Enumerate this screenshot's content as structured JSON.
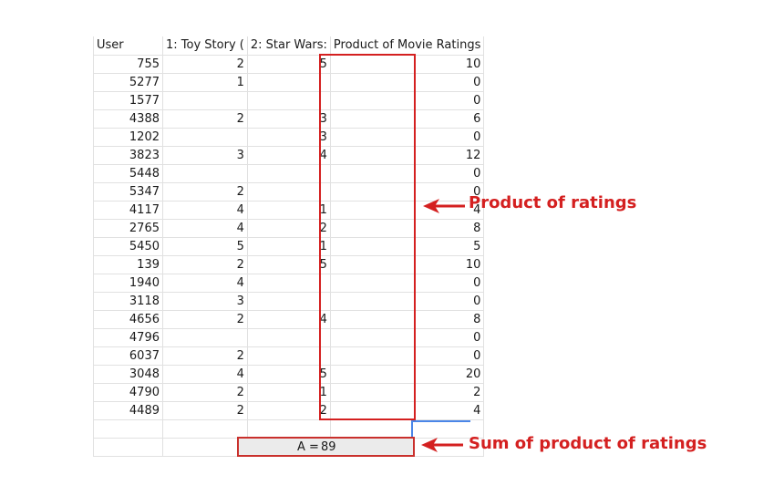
{
  "headers": [
    "User",
    "1: Toy Story (",
    "2: Star Wars:",
    "Product of Movie Ratings"
  ],
  "rows": [
    [
      "755",
      "2",
      "5",
      "10"
    ],
    [
      "5277",
      "1",
      "",
      "0"
    ],
    [
      "1577",
      "",
      "",
      "0"
    ],
    [
      "4388",
      "2",
      "3",
      "6"
    ],
    [
      "1202",
      "",
      "3",
      "0"
    ],
    [
      "3823",
      "3",
      "4",
      "12"
    ],
    [
      "5448",
      "",
      "",
      "0"
    ],
    [
      "5347",
      "2",
      "",
      "0"
    ],
    [
      "4117",
      "4",
      "1",
      "4"
    ],
    [
      "2765",
      "4",
      "2",
      "8"
    ],
    [
      "5450",
      "5",
      "1",
      "5"
    ],
    [
      "139",
      "2",
      "5",
      "10"
    ],
    [
      "1940",
      "4",
      "",
      "0"
    ],
    [
      "3118",
      "3",
      "",
      "0"
    ],
    [
      "4656",
      "2",
      "4",
      "8"
    ],
    [
      "4796",
      "",
      "",
      "0"
    ],
    [
      "6037",
      "2",
      "",
      "0"
    ],
    [
      "3048",
      "4",
      "5",
      "20"
    ],
    [
      "4790",
      "2",
      "1",
      "2"
    ],
    [
      "4489",
      "2",
      "2",
      "4"
    ]
  ],
  "sum": {
    "label": "A =",
    "value": "89"
  },
  "callouts": {
    "product": "Product of ratings",
    "sum": "Sum of product of ratings"
  },
  "colors": {
    "annotation": "#d42020",
    "selection": "#4a86e8"
  }
}
